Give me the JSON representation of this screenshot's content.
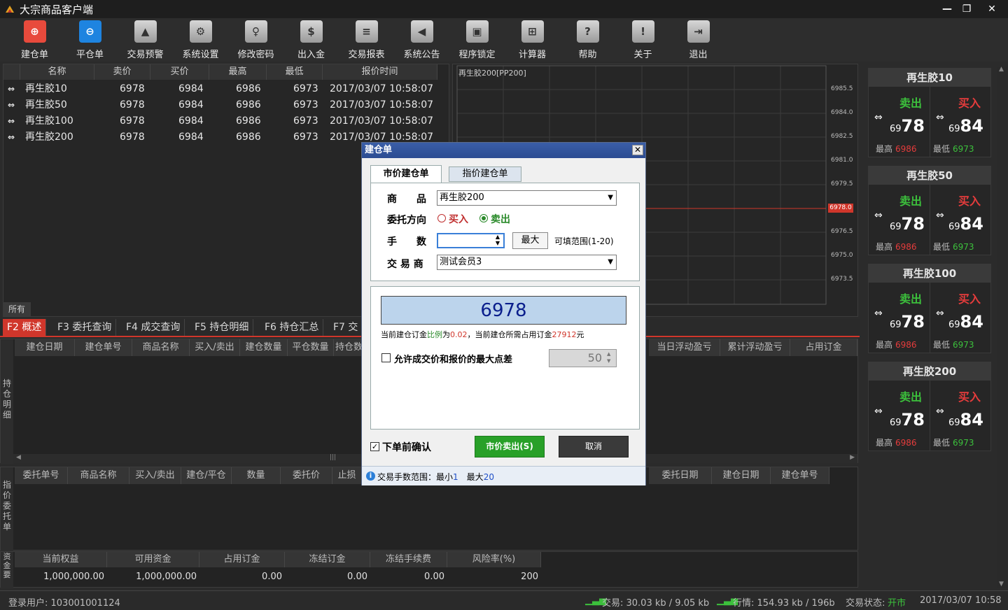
{
  "window": {
    "title": "大宗商品客户端"
  },
  "toolbar": [
    {
      "name": "open-order",
      "label": "建仓单",
      "icon": "plus-circle-icon",
      "glyph": "⊕",
      "color": "#e84a3c"
    },
    {
      "name": "close-order",
      "label": "平仓单",
      "icon": "minus-circle-icon",
      "glyph": "⊖",
      "color": "#1e84e0"
    },
    {
      "name": "trade-alert",
      "label": "交易预警",
      "icon": "alert-icon",
      "glyph": "▲"
    },
    {
      "name": "settings",
      "label": "系统设置",
      "icon": "gear-icon",
      "glyph": "⚙"
    },
    {
      "name": "change-password",
      "label": "修改密码",
      "icon": "key-icon",
      "glyph": "♀"
    },
    {
      "name": "deposit-withdraw",
      "label": "出入金",
      "icon": "money-bag-icon",
      "glyph": "$"
    },
    {
      "name": "trade-report",
      "label": "交易报表",
      "icon": "document-icon",
      "glyph": "≡"
    },
    {
      "name": "announcement",
      "label": "系统公告",
      "icon": "speaker-icon",
      "glyph": "◀"
    },
    {
      "name": "lock",
      "label": "程序锁定",
      "icon": "lock-icon",
      "glyph": "▣"
    },
    {
      "name": "calculator",
      "label": "计算器",
      "icon": "calculator-icon",
      "glyph": "⊞"
    },
    {
      "name": "help",
      "label": "帮助",
      "icon": "help-icon",
      "glyph": "?"
    },
    {
      "name": "about",
      "label": "关于",
      "icon": "info-icon",
      "glyph": "!"
    },
    {
      "name": "exit",
      "label": "退出",
      "icon": "exit-icon",
      "glyph": "⇥"
    }
  ],
  "quotes": {
    "headers": [
      "名称",
      "卖价",
      "买价",
      "最高",
      "最低",
      "报价时间"
    ],
    "rows": [
      {
        "name": "再生胶10",
        "sell": "6978",
        "buy": "6984",
        "high": "6986",
        "low": "6973",
        "time": "2017/03/07 10:58:07"
      },
      {
        "name": "再生胶50",
        "sell": "6978",
        "buy": "6984",
        "high": "6986",
        "low": "6973",
        "time": "2017/03/07 10:58:07"
      },
      {
        "name": "再生胶100",
        "sell": "6978",
        "buy": "6984",
        "high": "6986",
        "low": "6973",
        "time": "2017/03/07 10:58:07"
      },
      {
        "name": "再生胶200",
        "sell": "6978",
        "buy": "6984",
        "high": "6986",
        "low": "6973",
        "time": "2017/03/07 10:58:07"
      }
    ],
    "all_tab": "所有"
  },
  "chart": {
    "title": "再生胶200[PP200]",
    "y_ticks": [
      "6985.5",
      "6984.0",
      "6982.5",
      "6981.0",
      "6979.5",
      "6978.0",
      "6976.5",
      "6975.0",
      "6973.5"
    ],
    "current_price": "6978.0"
  },
  "bottom_tabs": [
    "F2 概述",
    "F3 委托查询",
    "F4 成交查询",
    "F5 持仓明细",
    "F6 持仓汇总",
    "F7 交"
  ],
  "positions": {
    "side_label": "持仓明细",
    "headers_left": [
      "建仓日期",
      "建仓单号",
      "商品名称",
      "买入/卖出",
      "建仓数量",
      "平仓数量",
      "持仓数"
    ],
    "headers_right": [
      "当日浮动盈亏",
      "累计浮动盈亏",
      "占用订金"
    ]
  },
  "limit_orders": {
    "side_label": "指价委托单",
    "headers_left": [
      "委托单号",
      "商品名称",
      "买入/卖出",
      "建仓/平仓",
      "数量",
      "委托价",
      "止损"
    ],
    "headers_right": [
      "委托日期",
      "建仓日期",
      "建仓单号"
    ]
  },
  "funds": {
    "side_label": "资金要",
    "headers": [
      "当前权益",
      "可用资金",
      "占用订金",
      "冻结订金",
      "冻结手续费",
      "风险率(%)"
    ],
    "values": [
      "1,000,000.00",
      "1,000,000.00",
      "0.00",
      "0.00",
      "0.00",
      "200"
    ]
  },
  "cards": [
    {
      "title": "再生胶10",
      "sell_label": "卖出",
      "buy_label": "买入",
      "sell_prefix": "69",
      "sell_main": "78",
      "buy_prefix": "69",
      "buy_main": "84",
      "high_label": "最高",
      "high": "6986",
      "low_label": "最低",
      "low": "6973"
    },
    {
      "title": "再生胶50",
      "sell_label": "卖出",
      "buy_label": "买入",
      "sell_prefix": "69",
      "sell_main": "78",
      "buy_prefix": "69",
      "buy_main": "84",
      "high_label": "最高",
      "high": "6986",
      "low_label": "最低",
      "low": "6973"
    },
    {
      "title": "再生胶100",
      "sell_label": "卖出",
      "buy_label": "买入",
      "sell_prefix": "69",
      "sell_main": "78",
      "buy_prefix": "69",
      "buy_main": "84",
      "high_label": "最高",
      "high": "6986",
      "low_label": "最低",
      "low": "6973"
    },
    {
      "title": "再生胶200",
      "sell_label": "卖出",
      "buy_label": "买入",
      "sell_prefix": "69",
      "sell_main": "78",
      "buy_prefix": "69",
      "buy_main": "84",
      "high_label": "最高",
      "high": "6986",
      "low_label": "最低",
      "low": "6973"
    }
  ],
  "status": {
    "user": "登录用户: 103001001124",
    "trade_traffic": "交易: 30.03 kb / 9.05 kb",
    "quote_traffic": "行情: 154.93 kb / 196b",
    "trade_status_label": "交易状态:",
    "trade_status_value": "开市",
    "datetime": "2017/03/07 10:58"
  },
  "modal": {
    "title": "建仓单",
    "tab_market": "市价建仓单",
    "tab_limit": "指价建仓单",
    "product_label": "商　　品",
    "product_value": "再生胶200",
    "direction_label": "委托方向",
    "buy_option": "买入",
    "sell_option": "卖出",
    "lots_label": "手　　数",
    "lots_value": "",
    "max_button": "最大",
    "range_hint": "可填范围(1-20)",
    "broker_label": "交 易 商",
    "broker_value": "测试会员3",
    "price": "6978",
    "margin_text_1": "当前建仓订金",
    "margin_ratio_label": "比例",
    "margin_text_2": "为",
    "margin_ratio": "0.02",
    "margin_text_3": "，当前建仓所需占用订金",
    "margin_amount": "27912",
    "margin_text_4": "元",
    "allow_spread_label": "允许成交价和报价的最大点差",
    "spread_value": "50",
    "confirm_label": "下单前确认",
    "submit_button": "市价卖出(S)",
    "cancel_button": "取消",
    "footer_text": "交易手数范围：最小",
    "footer_min": "1",
    "footer_max_label": "最大",
    "footer_max": "20"
  }
}
